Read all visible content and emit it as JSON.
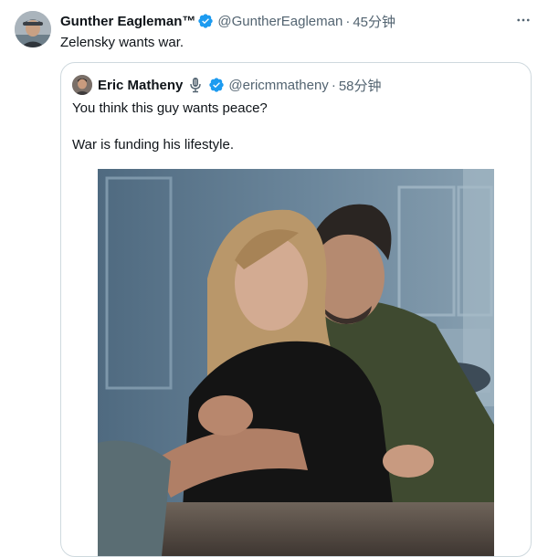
{
  "tweet": {
    "author_name": "Gunther Eagleman™",
    "author_handle": "@GuntherEagleman",
    "separator": "·",
    "time": "45分钟",
    "text": "Zelensky wants war.",
    "verified": true,
    "badge_color": "#1d9bf0"
  },
  "quoted_tweet": {
    "author_name": "Eric Matheny",
    "author_handle": "@ericmmatheny",
    "separator": "·",
    "time": "58分钟",
    "verified": true,
    "paragraphs": [
      "You think this guy wants peace?",
      "War is funding his lifestyle."
    ],
    "media": "photo"
  },
  "icons": {
    "verified": "verified-badge-icon",
    "microphone": "microphone-icon",
    "more": "more-options-icon"
  }
}
